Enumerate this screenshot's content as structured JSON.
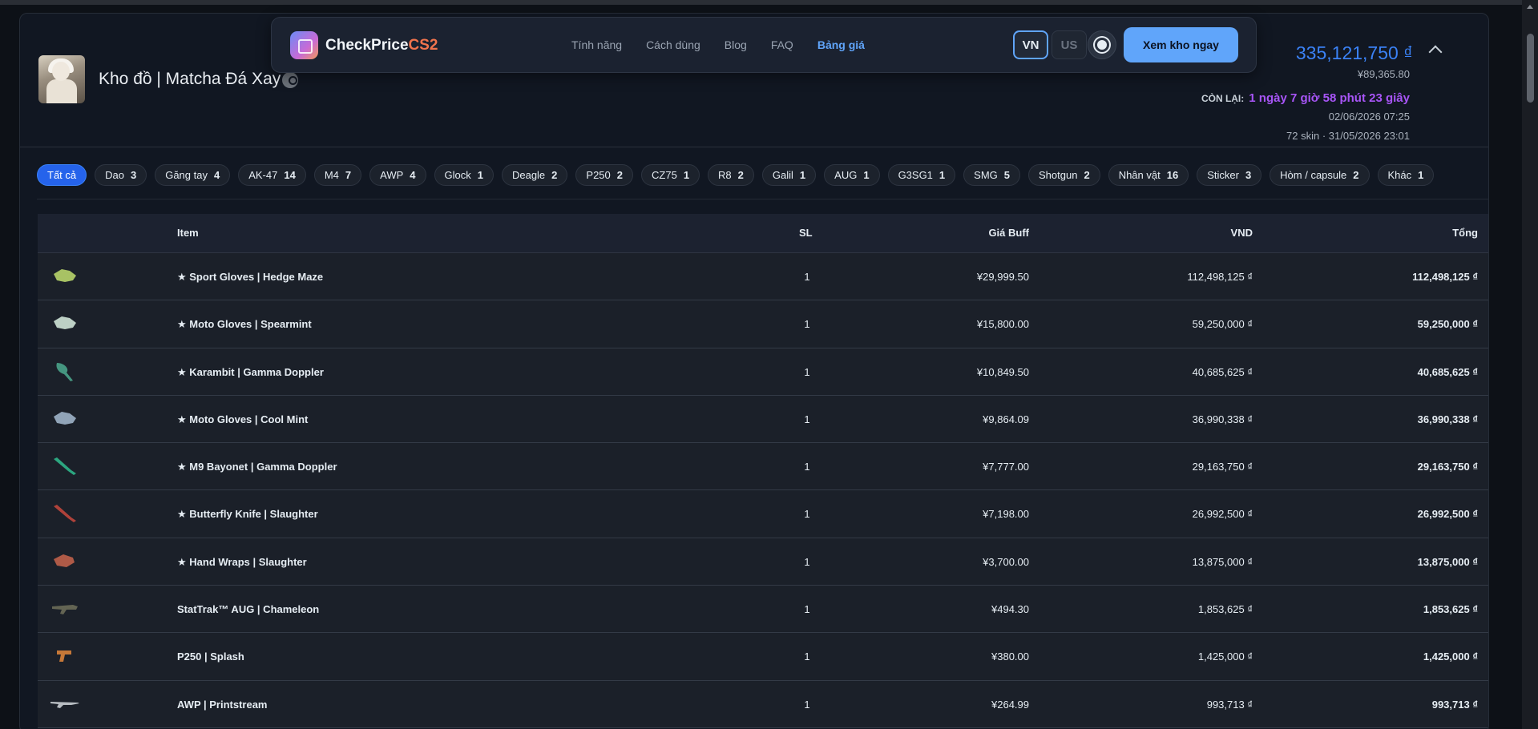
{
  "nav": {
    "brand_main": "CheckPrice",
    "brand_accent": "CS2",
    "links": [
      "Tính năng",
      "Cách dùng",
      "Blog",
      "FAQ",
      "Bảng giá"
    ],
    "lang_vn": "VN",
    "lang_us": "US",
    "cta": "Xem kho ngay"
  },
  "inventory": {
    "title": "Kho đồ | Matcha Đá Xay",
    "total_vnd": "335,121,750 ₫",
    "total_cny": "¥89,365.80",
    "remaining_label": "CÒN LẠI:",
    "remaining_value": "1 ngày 7 giờ 58 phút 23 giây",
    "expire_date": "02/06/2026 07:25",
    "summary": "72 skin · 31/05/2026 23:01"
  },
  "filters": [
    {
      "label": "Tất cả",
      "count": ""
    },
    {
      "label": "Dao",
      "count": "3"
    },
    {
      "label": "Găng tay",
      "count": "4"
    },
    {
      "label": "AK-47",
      "count": "14"
    },
    {
      "label": "M4",
      "count": "7"
    },
    {
      "label": "AWP",
      "count": "4"
    },
    {
      "label": "Glock",
      "count": "1"
    },
    {
      "label": "Deagle",
      "count": "2"
    },
    {
      "label": "P250",
      "count": "2"
    },
    {
      "label": "CZ75",
      "count": "1"
    },
    {
      "label": "R8",
      "count": "2"
    },
    {
      "label": "Galil",
      "count": "1"
    },
    {
      "label": "AUG",
      "count": "1"
    },
    {
      "label": "G3SG1",
      "count": "1"
    },
    {
      "label": "SMG",
      "count": "5"
    },
    {
      "label": "Shotgun",
      "count": "2"
    },
    {
      "label": "Nhân vật",
      "count": "16"
    },
    {
      "label": "Sticker",
      "count": "3"
    },
    {
      "label": "Hòm / capsule",
      "count": "2"
    },
    {
      "label": "Khác",
      "count": "1"
    }
  ],
  "table": {
    "headers": {
      "item": "Item",
      "sl": "SL",
      "buff": "Giá Buff",
      "vnd": "VND",
      "total": "Tổng"
    },
    "rows": [
      {
        "name": "★ Sport Gloves | Hedge Maze",
        "sl": "1",
        "buff": "¥29,999.50",
        "vnd": "112,498,125 ₫",
        "total": "112,498,125 ₫",
        "icon": "gloves-icon",
        "color": "#b8d46a"
      },
      {
        "name": "★ Moto Gloves | Spearmint",
        "sl": "1",
        "buff": "¥15,800.00",
        "vnd": "59,250,000 ₫",
        "total": "59,250,000 ₫",
        "icon": "gloves-icon",
        "color": "#cfe3d6"
      },
      {
        "name": "★ Karambit | Gamma Doppler",
        "sl": "1",
        "buff": "¥10,849.50",
        "vnd": "40,685,625 ₫",
        "total": "40,685,625 ₫",
        "icon": "karambit-icon",
        "color": "#4aa38a"
      },
      {
        "name": "★ Moto Gloves | Cool Mint",
        "sl": "1",
        "buff": "¥9,864.09",
        "vnd": "36,990,338 ₫",
        "total": "36,990,338 ₫",
        "icon": "gloves-icon",
        "color": "#9fb3c8"
      },
      {
        "name": "★ M9 Bayonet | Gamma Doppler",
        "sl": "1",
        "buff": "¥7,777.00",
        "vnd": "29,163,750 ₫",
        "total": "29,163,750 ₫",
        "icon": "knife-icon",
        "color": "#2fb58a"
      },
      {
        "name": "★ Butterfly Knife | Slaughter",
        "sl": "1",
        "buff": "¥7,198.00",
        "vnd": "26,992,500 ₫",
        "total": "26,992,500 ₫",
        "icon": "knife-icon",
        "color": "#c0463c"
      },
      {
        "name": "★ Hand Wraps | Slaughter",
        "sl": "1",
        "buff": "¥3,700.00",
        "vnd": "13,875,000 ₫",
        "total": "13,875,000 ₫",
        "icon": "wraps-icon",
        "color": "#c0604a"
      },
      {
        "name": "StatTrak™ AUG | Chameleon",
        "sl": "1",
        "buff": "¥494.30",
        "vnd": "1,853,625 ₫",
        "total": "1,853,625 ₫",
        "icon": "rifle-icon",
        "color": "#6b6b58"
      },
      {
        "name": "P250 | Splash",
        "sl": "1",
        "buff": "¥380.00",
        "vnd": "1,425,000 ₫",
        "total": "1,425,000 ₫",
        "icon": "pistol-icon",
        "color": "#d9823a"
      },
      {
        "name": "AWP | Printstream",
        "sl": "1",
        "buff": "¥264.99",
        "vnd": "993,713 ₫",
        "total": "993,713 ₫",
        "icon": "sniper-icon",
        "color": "#c9cdd2"
      }
    ]
  },
  "colors": {
    "accent": "#60a5fa",
    "total_blue": "#3b82f6",
    "timer_purple": "#a855f7",
    "brand_orange": "#f1744d",
    "chip_active": "#2563eb"
  }
}
